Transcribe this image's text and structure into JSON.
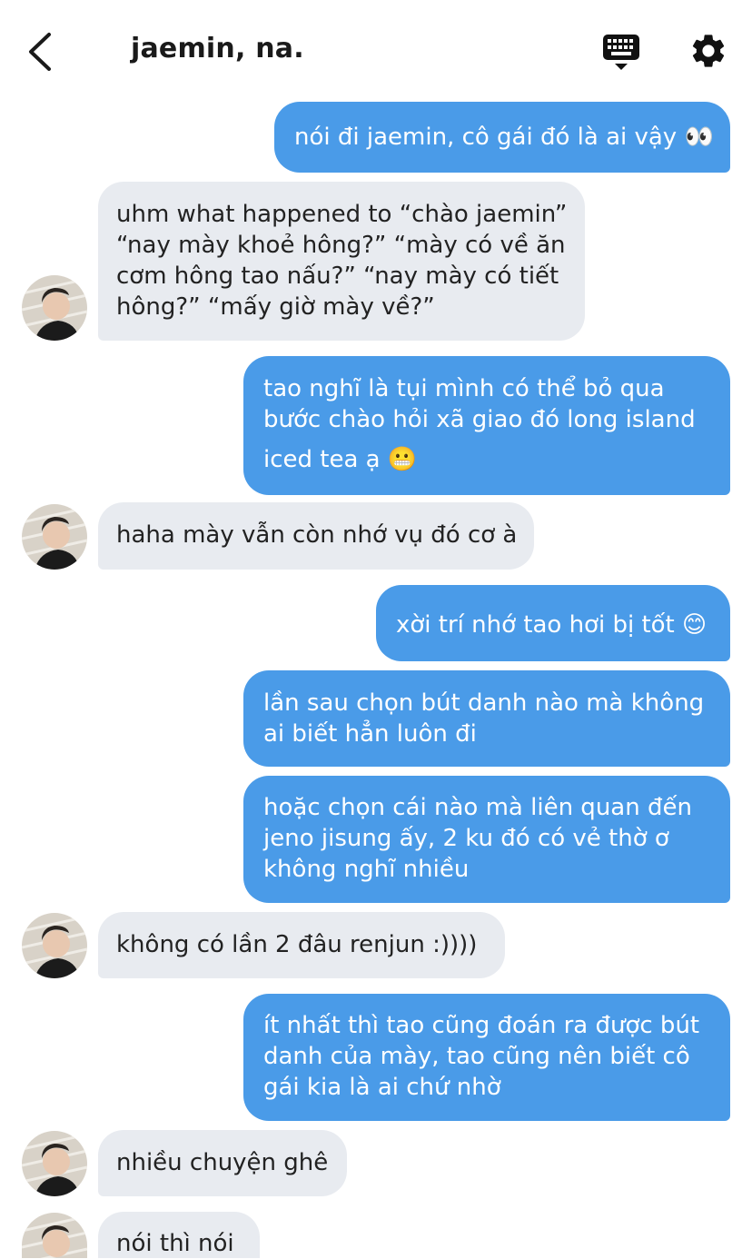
{
  "header": {
    "title": "jaemin, na."
  },
  "messages": [
    {
      "from": "me",
      "lines": [
        "nói đi jaemin, cô gái đó là ai vậy 👀"
      ]
    },
    {
      "from": "them",
      "lines": [
        "uhm what happened to “chào jaemin”",
        "“nay mày khoẻ hông?” “mày có về ăn",
        "cơm hông tao nấu?” “nay mày có tiết",
        "hông?” “mấy giờ mày về?”"
      ]
    },
    {
      "from": "me",
      "lines": [
        "tao nghĩ là tụi mình có thể bỏ qua",
        "bước chào hỏi xã giao đó long island",
        "iced tea ạ 😬"
      ]
    },
    {
      "from": "them",
      "lines": [
        "haha mày vẫn còn nhớ vụ đó cơ à"
      ]
    },
    {
      "from": "me",
      "lines": [
        "xời trí nhớ tao hơi bị tốt 😊"
      ]
    },
    {
      "from": "me",
      "lines": [
        "lần sau chọn bút danh nào mà không",
        "ai biết hẳn luôn đi"
      ]
    },
    {
      "from": "me",
      "lines": [
        "hoặc chọn cái nào mà liên quan đến",
        "jeno jisung ấy, 2 ku đó có vẻ thờ ơ",
        "không nghĩ nhiều"
      ]
    },
    {
      "from": "them",
      "lines": [
        "không có lần 2 đâu renjun :))))"
      ]
    },
    {
      "from": "me",
      "lines": [
        "ít nhất thì tao cũng đoán ra được bút",
        "danh của mày, tao cũng nên biết cô",
        "gái kia là ai chứ nhờ"
      ]
    },
    {
      "from": "them",
      "lines": [
        "nhiều chuyện ghê"
      ]
    },
    {
      "from": "them",
      "lines": [
        "nói thì nói"
      ]
    }
  ]
}
